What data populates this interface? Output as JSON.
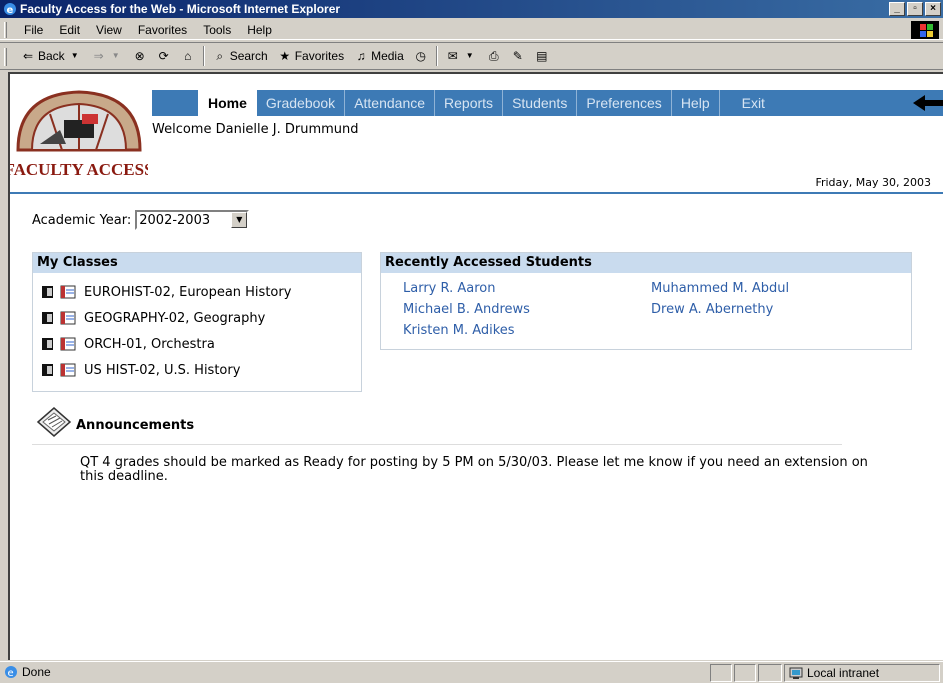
{
  "window": {
    "title": "Faculty Access for the Web - Microsoft Internet Explorer"
  },
  "menu": [
    "File",
    "Edit",
    "View",
    "Favorites",
    "Tools",
    "Help"
  ],
  "toolbar": {
    "back": "Back",
    "search": "Search",
    "favorites": "Favorites",
    "media": "Media"
  },
  "header": {
    "logo_text": "FACULTY ACCESS",
    "nav": [
      "Home",
      "Gradebook",
      "Attendance",
      "Reports",
      "Students",
      "Preferences",
      "Help",
      "Exit"
    ],
    "welcome": "Welcome Danielle J. Drummund",
    "date": "Friday, May 30, 2003"
  },
  "academic_year": {
    "label": "Academic Year:",
    "value": "2002-2003"
  },
  "my_classes": {
    "title": "My Classes",
    "items": [
      "EUROHIST-02, European History",
      "GEOGRAPHY-02, Geography",
      "ORCH-01, Orchestra",
      "US HIST-02, U.S. History"
    ]
  },
  "recent_students": {
    "title": "Recently Accessed Students",
    "items": [
      "Larry R. Aaron",
      "Michael B. Andrews",
      "Kristen M. Adikes",
      "Muhammed M. Abdul",
      "Drew A. Abernethy"
    ]
  },
  "announcements": {
    "title": "Announcements",
    "text": "QT 4 grades should be marked as Ready for posting by 5 PM on 5/30/03. Please let me know if you need an extension on this deadline."
  },
  "status": {
    "text": "Done",
    "zone": "Local intranet"
  },
  "colors": {
    "nav_bg": "#3d7ab5",
    "panel_head": "#c9dbee",
    "link": "#2e5ea8",
    "titlebar": "#0a246a"
  }
}
